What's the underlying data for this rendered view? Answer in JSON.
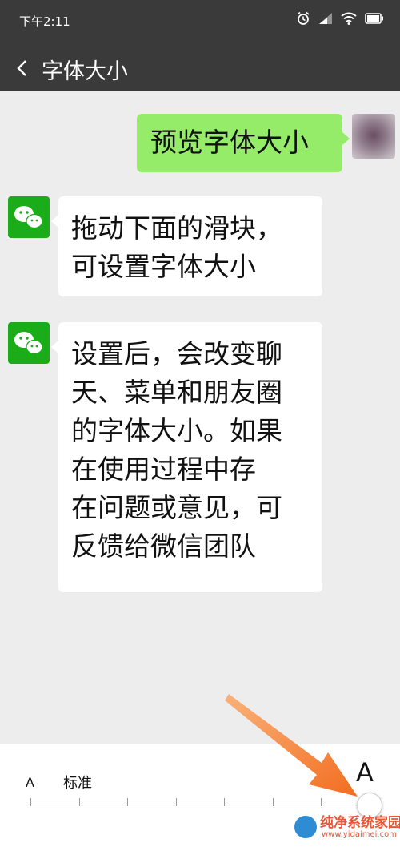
{
  "status_bar": {
    "time": "下午2:11",
    "icons": [
      "alarm-icon",
      "signal-icon",
      "wifi-icon",
      "battery-icon"
    ]
  },
  "header": {
    "title": "字体大小",
    "back_icon": "chevron-left-icon"
  },
  "messages": [
    {
      "sender": "me",
      "lines": [
        "预览字体大小"
      ]
    },
    {
      "sender": "wechat",
      "lines": [
        "拖动下面的滑块，",
        "可设置字体大小"
      ]
    },
    {
      "sender": "wechat",
      "lines": [
        "设置后，会改变聊",
        "天、菜单和朋友圈",
        "的字体大小。如果",
        "在使用过程中存",
        "在问题或意见，可",
        "反馈给微信团队"
      ]
    }
  ],
  "font_slider": {
    "small_label": "A",
    "standard_label": "标准",
    "large_label": "A",
    "steps": 8,
    "selected_step": 7
  },
  "watermark": {
    "name": "纯净系统家园",
    "url": "www.yidaimei.com"
  },
  "colors": {
    "title_bar": "#3a3a3a",
    "my_bubble": "#95ec69",
    "other_bubble": "#ffffff",
    "background": "#ededed",
    "wechat_green": "#1aad19",
    "arrow": "#f27d2d"
  }
}
